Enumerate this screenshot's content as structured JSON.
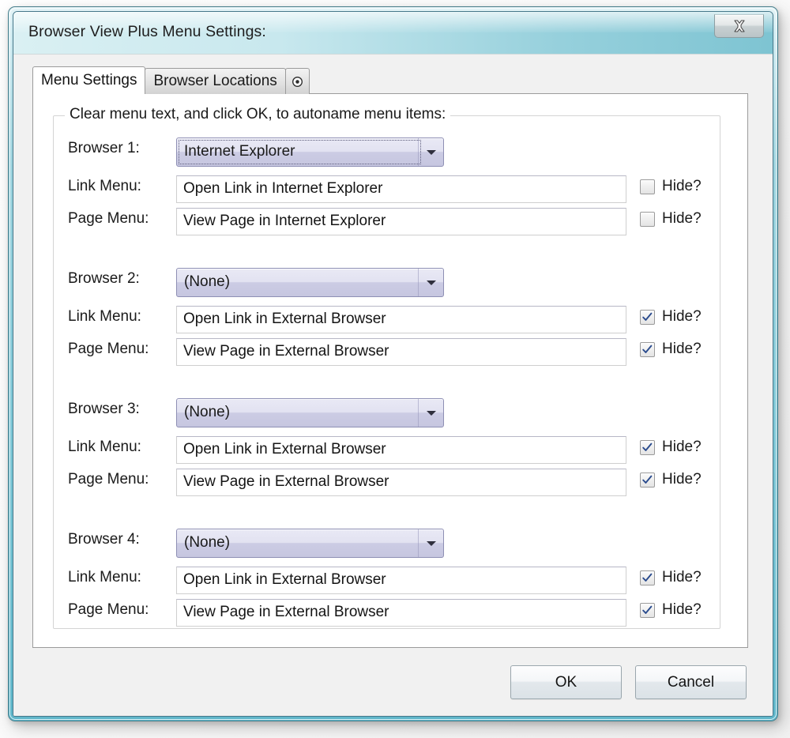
{
  "window": {
    "title": "Browser View Plus Menu Settings:",
    "close_icon": "close-icon"
  },
  "tabs": [
    {
      "label": "Menu Settings",
      "active": true
    },
    {
      "label": "Browser Locations",
      "active": false
    },
    {
      "label": "",
      "icon": "target-dot-icon",
      "active": false
    }
  ],
  "groupbox": {
    "legend": "Clear menu text, and click OK, to autoname menu items:"
  },
  "labels": {
    "link_menu": "Link Menu:",
    "page_menu": "Page Menu:",
    "hide": "Hide?"
  },
  "browsers": [
    {
      "label": "Browser 1:",
      "selected": "Internet Explorer",
      "focused": true,
      "link_menu_value": "Open Link in Internet Explorer",
      "link_menu_hidden": false,
      "page_menu_value": "View Page in Internet Explorer",
      "page_menu_hidden": false
    },
    {
      "label": "Browser 2:",
      "selected": "(None)",
      "focused": false,
      "link_menu_value": "Open Link in External Browser",
      "link_menu_hidden": true,
      "page_menu_value": "View Page in External Browser",
      "page_menu_hidden": true
    },
    {
      "label": "Browser 3:",
      "selected": "(None)",
      "focused": false,
      "link_menu_value": "Open Link in External Browser",
      "link_menu_hidden": true,
      "page_menu_value": "View Page in External Browser",
      "page_menu_hidden": true
    },
    {
      "label": "Browser 4:",
      "selected": "(None)",
      "focused": false,
      "link_menu_value": "Open Link in External Browser",
      "link_menu_hidden": true,
      "page_menu_value": "View Page in External Browser",
      "page_menu_hidden": true
    }
  ],
  "footer": {
    "ok_label": "OK",
    "cancel_label": "Cancel"
  },
  "colors": {
    "frame": "#78c4d4",
    "titlebar": "#cce8ee",
    "combo_fill": "#cccce4",
    "check_mark": "#2a4b8d",
    "panel": "#ffffff",
    "dialog": "#f1f1f1"
  }
}
